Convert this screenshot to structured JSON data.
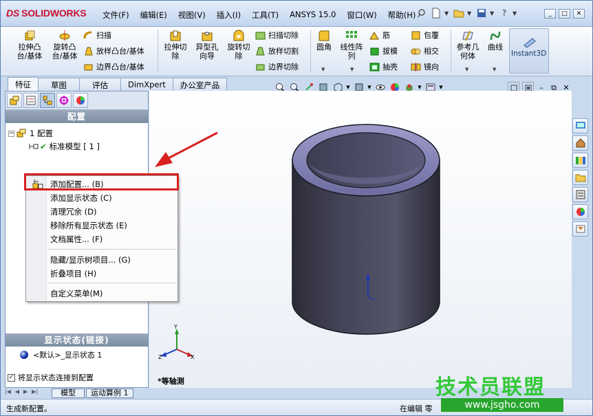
{
  "app": {
    "logo_prefix": "DS",
    "logo_text": "SOLIDWORKS"
  },
  "menu": [
    "文件(F)",
    "编辑(E)",
    "视图(V)",
    "插入(I)",
    "工具(T)",
    "ANSYS 15.0",
    "窗口(W)",
    "帮助(H)"
  ],
  "ribbon": {
    "extrude_boss": "拉伸凸\n台/基体",
    "revolve_boss": "旋转凸\n台/基体",
    "sweep": "扫描",
    "loft": "放样凸台/基体",
    "boundary_boss": "边界凸台/基体",
    "extrude_cut": "拉伸切\n除",
    "hole_wizard": "异型孔\n向导",
    "revolve_cut": "旋转切\n除",
    "swept_cut": "扫描切除",
    "lofted_cut": "放样切割",
    "boundary_cut": "边界切除",
    "fillet": "圆角",
    "linear_pattern": "线性阵\n列",
    "rib": "筋",
    "draft": "拔模",
    "shell": "抽壳",
    "wrap": "包覆",
    "intersect": "相交",
    "mirror": "镜向",
    "ref_geometry": "参考几\n何体",
    "curves": "曲线",
    "instant3d": "Instant3D"
  },
  "tabs": [
    "特征",
    "草图",
    "评估",
    "DimXpert",
    "办公室产品"
  ],
  "panel": {
    "config_header": "配置",
    "config_root": "1 配置",
    "config_default": "标准模型 [ 1 ]",
    "display_header": "显示状态(链接)",
    "display_item": "<默认>_显示状态 1",
    "link_checkbox": "将显示状态连接到配置"
  },
  "context_menu": {
    "items": [
      "添加配置... (B)",
      "添加显示状态 (C)",
      "清理冗余 (D)",
      "移除所有显示状态 (E)",
      "文档属性... (F)",
      "隐藏/显示树项目... (G)",
      "折叠项目 (H)",
      "自定义菜单(M)"
    ]
  },
  "viewport": {
    "view_label": "*等轴测",
    "axis_x": "X",
    "axis_y": "Y",
    "axis_z": "Z"
  },
  "bottom_tabs": [
    "模型",
    "运动算例 1"
  ],
  "status": {
    "left": "生成新配置。",
    "right": "在编辑 零"
  },
  "watermark": {
    "text": "技术员联盟",
    "url": "www.jsgho.com"
  },
  "colors": {
    "highlight": "#d8201f",
    "cylinder": "#3f3f52",
    "accent": "#c8102e"
  }
}
